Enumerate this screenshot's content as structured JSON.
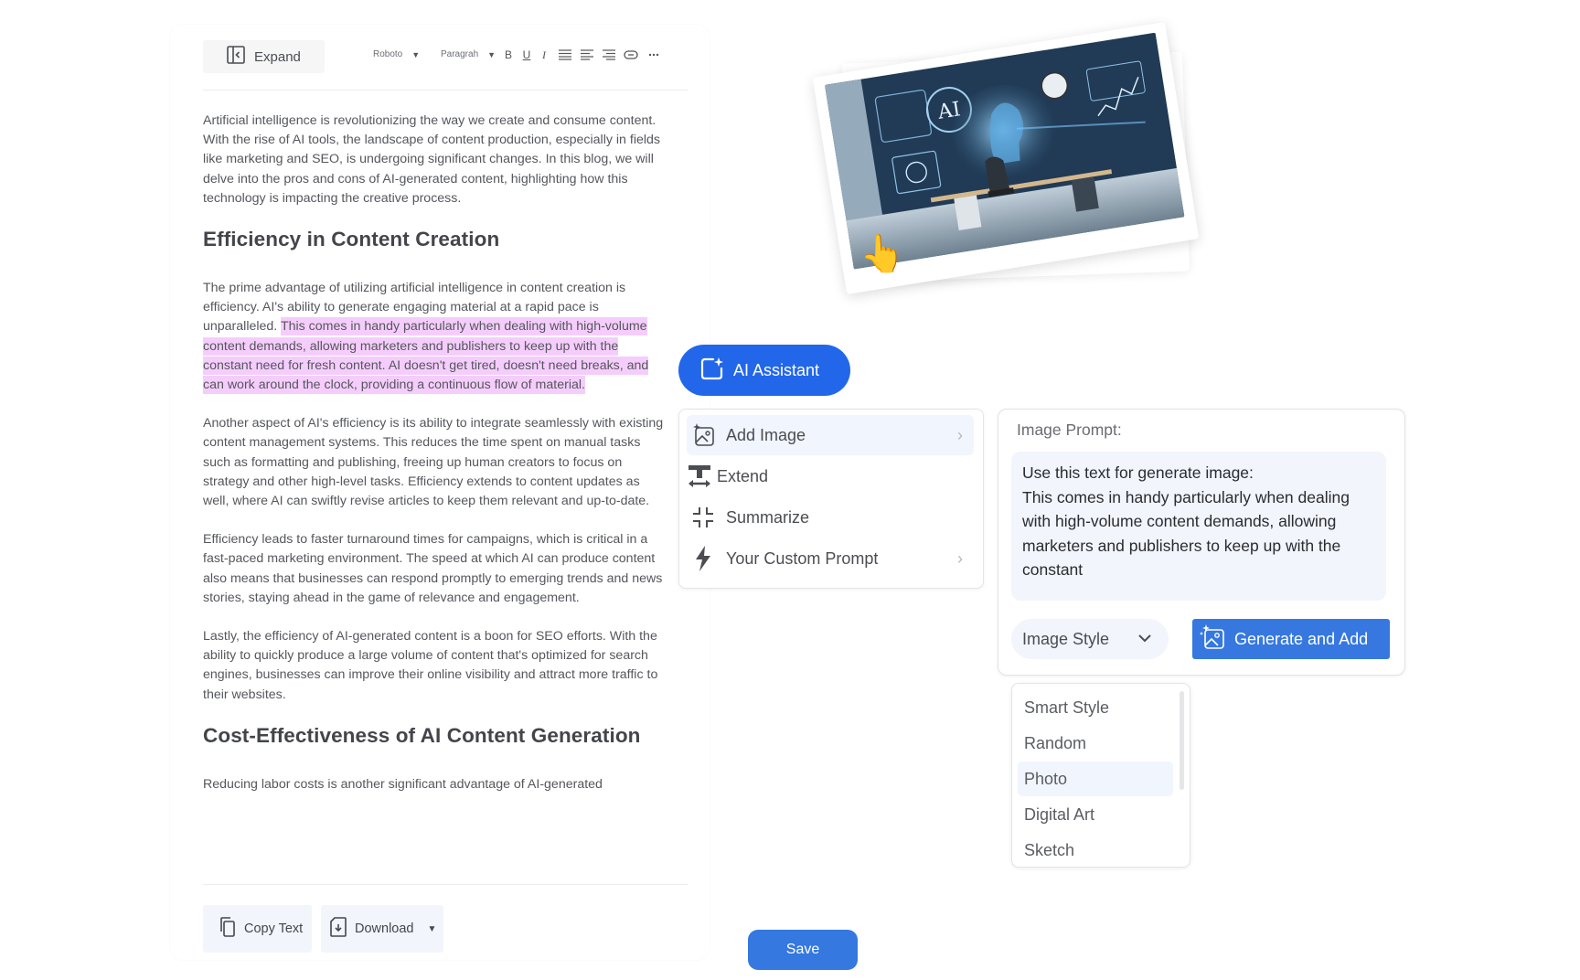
{
  "editor": {
    "toolbar": {
      "expand_label": "Expand",
      "font_family": "Roboto",
      "block_type": "Paragrah",
      "bold": "B",
      "underline": "U",
      "italic": "I",
      "icons": [
        "bold-icon",
        "underline-icon",
        "italic-icon",
        "align-justify-icon",
        "align-left-icon",
        "align-right-icon",
        "link-icon",
        "more-icon"
      ]
    },
    "content": {
      "intro": "Artificial intelligence is revolutionizing the way we create and consume content. With the rise of AI tools, the landscape of content production, especially in fields like marketing and SEO, is undergoing significant changes. In this blog, we will delve into the pros and cons of AI-generated content, highlighting how this technology is impacting the creative process.",
      "heading1": "Efficiency in Content Creation",
      "p1_plain": "The prime advantage of utilizing artificial intelligence in content creation is efficiency. AI's ability to generate engaging material at a rapid pace is unparalleled. ",
      "p1_highlighted": "This comes in handy particularly when dealing with high-volume content demands, allowing marketers and publishers to keep up with the constant need for fresh content. AI doesn't get tired, doesn't need breaks, and can work around the clock, providing a continuous flow of material. ",
      "p2": "Another aspect of AI's efficiency is its ability to integrate seamlessly with existing content management systems. This reduces the time spent on manual tasks such as formatting and publishing, freeing up human creators to focus on strategy and other high-level tasks. Efficiency extends to content updates as well, where AI can swiftly revise articles to keep them relevant and up-to-date.",
      "p3": "Efficiency leads to faster turnaround times for campaigns, which is critical in a fast-paced marketing environment. The speed at which AI can produce content also means that businesses can respond promptly to emerging trends and news stories, staying ahead in the game of relevance and engagement.",
      "p4": "Lastly, the efficiency of AI-generated content is a boon for SEO efforts. With the ability to quickly produce a large volume of content that's optimized for search engines, businesses can improve their online visibility and attract more traffic to their websites.",
      "heading2": "Cost-Effectiveness of AI Content Generation",
      "p5_cutoff": "Reducing labor costs is another significant advantage of AI-generated"
    },
    "footer": {
      "copy_label": "Copy Text",
      "download_label": "Download",
      "save_label": "Save"
    }
  },
  "generated_image": {
    "alt": "AI workspace illustration with person at desk facing holographic AI dashboards",
    "overlay_text": "AI"
  },
  "ai_assistant": {
    "button_label": "AI Assistant",
    "menu": [
      {
        "label": "Add Image",
        "icon": "add-image-icon",
        "has_submenu": true,
        "active": true
      },
      {
        "label": "Extend",
        "icon": "extend-icon",
        "has_submenu": false,
        "active": false
      },
      {
        "label": "Summarize",
        "icon": "summarize-icon",
        "has_submenu": false,
        "active": false
      },
      {
        "label": "Your Custom Prompt",
        "icon": "bolt-icon",
        "has_submenu": true,
        "active": false
      }
    ]
  },
  "image_prompt": {
    "title": "Image Prompt:",
    "text": "Use this text for generate image:\nThis comes in handy particularly when dealing with high-volume content demands, allowing marketers and publishers to keep up with the constant",
    "style_select_label": "Image Style",
    "generate_label": "Generate and Add",
    "style_options": [
      "Smart Style",
      "Random",
      "Photo",
      "Digital Art",
      "Sketch"
    ],
    "hovered_option": "Photo"
  },
  "colors": {
    "primary": "#2267ea",
    "button_blue": "#3678e0",
    "highlight": "#f5cdfc",
    "soft_bg": "#f2f5fc"
  }
}
